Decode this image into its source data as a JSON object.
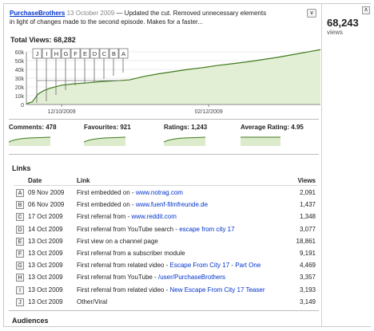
{
  "video_comment": {
    "user": "PurchaseBrothers",
    "separator": "—",
    "date": "13 October 2009",
    "text_line1": "— Updated the cut. Removed unnecessary elements",
    "text_line2": "in light of changes made to the second episode. Makes for a faster..."
  },
  "side": {
    "views_count": "68,243",
    "views_label": "views",
    "collapse_icon": "double-chevron-up-icon"
  },
  "total_views_label": "Total Views: 68,282",
  "chart_data": {
    "type": "area",
    "title": "Total Views: 68,282",
    "x_ticks": [
      "12/10/2009",
      "02/12/2009"
    ],
    "y_ticks": [
      "0",
      "10k",
      "20k",
      "30k",
      "40k",
      "50k",
      "60k"
    ],
    "ylim": [
      0,
      60000
    ],
    "x": [
      0,
      2,
      4,
      6,
      8,
      12,
      16,
      20,
      25,
      30,
      35,
      40,
      45,
      50,
      55,
      60,
      65,
      70,
      75,
      80,
      85,
      90,
      95,
      100
    ],
    "values": [
      800,
      3000,
      12000,
      16000,
      18500,
      22000,
      23500,
      24500,
      26000,
      27000,
      28000,
      32000,
      35000,
      37500,
      40000,
      42000,
      44500,
      46500,
      48500,
      51000,
      53500,
      56500,
      59500,
      62500
    ],
    "line_color": "#3f7a1c",
    "fill_color": "#e3efd5",
    "markers": [
      "J",
      "I",
      "H",
      "G",
      "F",
      "E",
      "D",
      "C",
      "B",
      "A"
    ]
  },
  "stats": [
    {
      "label": "Comments: 478"
    },
    {
      "label": "Favourites: 921"
    },
    {
      "label": "Ratings: 1,243"
    },
    {
      "label": "Average Rating: 4.95"
    }
  ],
  "links_title": "Links",
  "links_table": {
    "headers": {
      "date": "Date",
      "link": "Link",
      "views": "Views"
    },
    "rows": [
      {
        "id": "A",
        "date": "09 Nov 2009",
        "text": "First embedded on - ",
        "link": "www.notrag.com",
        "views": "2,091"
      },
      {
        "id": "B",
        "date": "06 Nov 2009",
        "text": "First embedded on - ",
        "link": "www.fuenf-filmfreunde.de",
        "views": "1,437"
      },
      {
        "id": "C",
        "date": "17 Oct 2009",
        "text": "First referral from - ",
        "link": "www.reddit.com",
        "views": "1,348"
      },
      {
        "id": "D",
        "date": "14 Oct 2009",
        "text": "First referral from YouTube search - ",
        "link": "escape from city 17",
        "views": "3,077"
      },
      {
        "id": "E",
        "date": "13 Oct 2009",
        "text": "First view on a channel page",
        "link": "",
        "views": "18,861"
      },
      {
        "id": "F",
        "date": "13 Oct 2009",
        "text": "First referral from a subscriber module",
        "link": "",
        "views": "9,191"
      },
      {
        "id": "G",
        "date": "13 Oct 2009",
        "text": "First referral from related video - ",
        "link": "Escape From City 17 - Part One",
        "views": "4,469"
      },
      {
        "id": "H",
        "date": "13 Oct 2009",
        "text": "First referral from YouTube - ",
        "link": "/user/PurchaseBrothers",
        "views": "3,357"
      },
      {
        "id": "I",
        "date": "13 Oct 2009",
        "text": "First referral from related video - ",
        "link": "New Escape From City 17 Teaser",
        "views": "3,193"
      },
      {
        "id": "J",
        "date": "13 Oct 2009",
        "text": "Other/Viral",
        "link": "",
        "views": "3,149"
      }
    ]
  },
  "audiences_title": "Audiences"
}
